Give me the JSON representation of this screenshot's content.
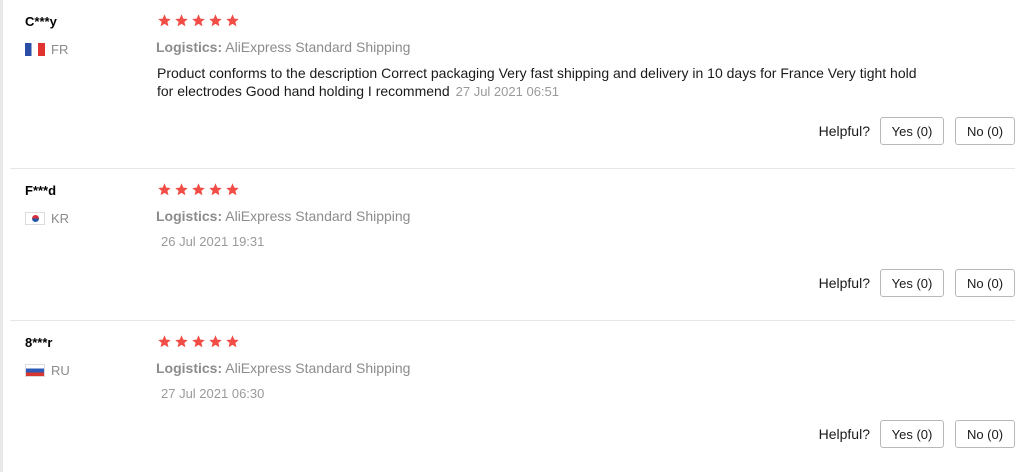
{
  "reviews": [
    {
      "user": "C***y",
      "country": "FR",
      "flag": "france-flag-icon",
      "rating": 5,
      "logistics_label": "Logistics:",
      "logistics_value": "AliExpress Standard Shipping",
      "text": "Product conforms to the description Correct packaging Very fast shipping and delivery in 10 days for France Very tight hold for electrodes Good hand holding I recommend",
      "date": "27 Jul 2021 06:51",
      "helpful_label": "Helpful?",
      "yes_label": "Yes (0)",
      "no_label": "No (0)"
    },
    {
      "user": "F***d",
      "country": "KR",
      "flag": "south-korea-flag-icon",
      "rating": 5,
      "logistics_label": "Logistics:",
      "logistics_value": "AliExpress Standard Shipping",
      "text": "",
      "date": "26 Jul 2021 19:31",
      "helpful_label": "Helpful?",
      "yes_label": "Yes (0)",
      "no_label": "No (0)"
    },
    {
      "user": "8***r",
      "country": "RU",
      "flag": "russia-flag-icon",
      "rating": 5,
      "logistics_label": "Logistics:",
      "logistics_value": "AliExpress Standard Shipping",
      "text": "",
      "date": "27 Jul 2021 06:30",
      "helpful_label": "Helpful?",
      "yes_label": "Yes (0)",
      "no_label": "No (0)"
    }
  ],
  "colors": {
    "star": "#f14c46",
    "muted_text": "#8c8c8c",
    "button_border": "#b8b8b8",
    "divider": "#e6e6e6"
  }
}
